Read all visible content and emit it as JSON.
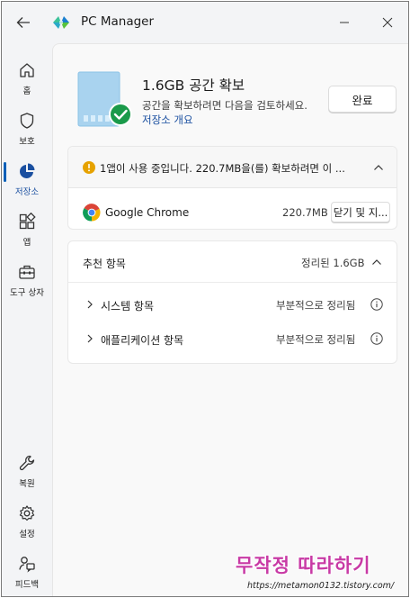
{
  "titlebar": {
    "title": "PC Manager",
    "back_icon": "back-arrow-icon",
    "minimize_icon": "minimize-icon",
    "close_icon": "close-icon"
  },
  "nav": {
    "items": [
      {
        "label": "홈",
        "icon": "home-icon"
      },
      {
        "label": "보호",
        "icon": "shield-icon"
      },
      {
        "label": "저장소",
        "icon": "storage-pie-icon",
        "active": true
      },
      {
        "label": "앱",
        "icon": "apps-icon"
      },
      {
        "label": "도구 상자",
        "icon": "toolbox-icon"
      },
      {
        "label": "복원",
        "icon": "wrench-icon"
      },
      {
        "label": "설정",
        "icon": "gear-icon"
      },
      {
        "label": "피드백",
        "icon": "feedback-icon"
      }
    ]
  },
  "hero": {
    "title": "1.6GB 공간 확보",
    "description": "공간을 확보하려면 다음을 검토하세요.",
    "link": "저장소 개요",
    "done_button": "완료"
  },
  "running_apps": {
    "warning": "1앱이 사용 중입니다. 220.7MB을(를) 확보하려면 이 ...",
    "app": {
      "name": "Google Chrome",
      "size": "220.7MB",
      "action": "닫기 및 지..."
    }
  },
  "recommendations": {
    "title": "추천 항목",
    "summary": "정리된 1.6GB",
    "rows": [
      {
        "label": "시스템 항목",
        "status": "부분적으로 정리됨"
      },
      {
        "label": "애플리케이션 항목",
        "status": "부분적으로 정리됨"
      }
    ]
  },
  "watermark": {
    "title": "무작정 따라하기",
    "url": "https://metamon0132.tistory.com/"
  },
  "colors": {
    "accent": "#005fb8",
    "success": "#1a9a4a",
    "warning": "#e6a200",
    "watermark": "#c83aa5"
  }
}
